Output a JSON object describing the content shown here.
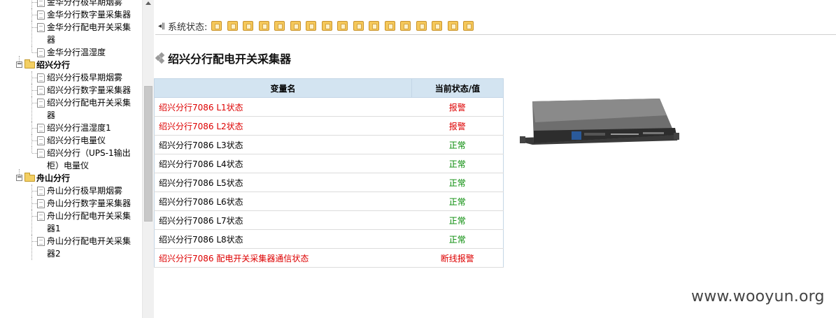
{
  "sidebar": {
    "tree": [
      {
        "type": "item",
        "label": "金华分行极早期烟雾"
      },
      {
        "type": "item",
        "label": "金华分行数字量采集器"
      },
      {
        "type": "item",
        "label": "金华分行配电开关采集器"
      },
      {
        "type": "item",
        "label": "金华分行温湿度",
        "last": true
      },
      {
        "type": "group",
        "label": "绍兴分行"
      },
      {
        "type": "item",
        "label": "绍兴分行极早期烟雾"
      },
      {
        "type": "item",
        "label": "绍兴分行数字量采集器"
      },
      {
        "type": "item",
        "label": "绍兴分行配电开关采集器"
      },
      {
        "type": "item",
        "label": "绍兴分行温湿度1"
      },
      {
        "type": "item",
        "label": "绍兴分行电量仪"
      },
      {
        "type": "item",
        "label": "绍兴分行（UPS-1输出柜）电量仪",
        "last": true
      },
      {
        "type": "group",
        "label": "舟山分行"
      },
      {
        "type": "item",
        "label": "舟山分行极早期烟雾"
      },
      {
        "type": "item",
        "label": "舟山分行数字量采集器"
      },
      {
        "type": "item",
        "label": "舟山分行配电开关采集器1"
      },
      {
        "type": "item",
        "label": "舟山分行配电开关采集器2"
      }
    ],
    "group_expand_symbol": "−"
  },
  "status_bar": {
    "label": "系统状态:",
    "icon_name": "status-light-icon",
    "icon_count": 17
  },
  "page_title": "绍兴分行配电开关采集器",
  "table": {
    "headers": [
      "变量名",
      "当前状态/值"
    ],
    "rows": [
      {
        "name": "绍兴分行7086 L1状态",
        "value": "报警",
        "color": "red"
      },
      {
        "name": "绍兴分行7086 L2状态",
        "value": "报警",
        "color": "red"
      },
      {
        "name": "绍兴分行7086 L3状态",
        "value": "正常",
        "color": "green"
      },
      {
        "name": "绍兴分行7086 L4状态",
        "value": "正常",
        "color": "green"
      },
      {
        "name": "绍兴分行7086 L5状态",
        "value": "正常",
        "color": "green"
      },
      {
        "name": "绍兴分行7086 L6状态",
        "value": "正常",
        "color": "green"
      },
      {
        "name": "绍兴分行7086 L7状态",
        "value": "正常",
        "color": "green"
      },
      {
        "name": "绍兴分行7086 L8状态",
        "value": "正常",
        "color": "green"
      },
      {
        "name": "绍兴分行7086 配电开关采集器通信状态",
        "value": "断线报警",
        "color": "red"
      }
    ]
  },
  "device_image": {
    "icon": "rack-device-icon"
  },
  "watermark": "www.wooyun.org",
  "colors": {
    "alarm": "#dd0000",
    "normal": "#008800",
    "header_bg": "#d3e4f1"
  }
}
